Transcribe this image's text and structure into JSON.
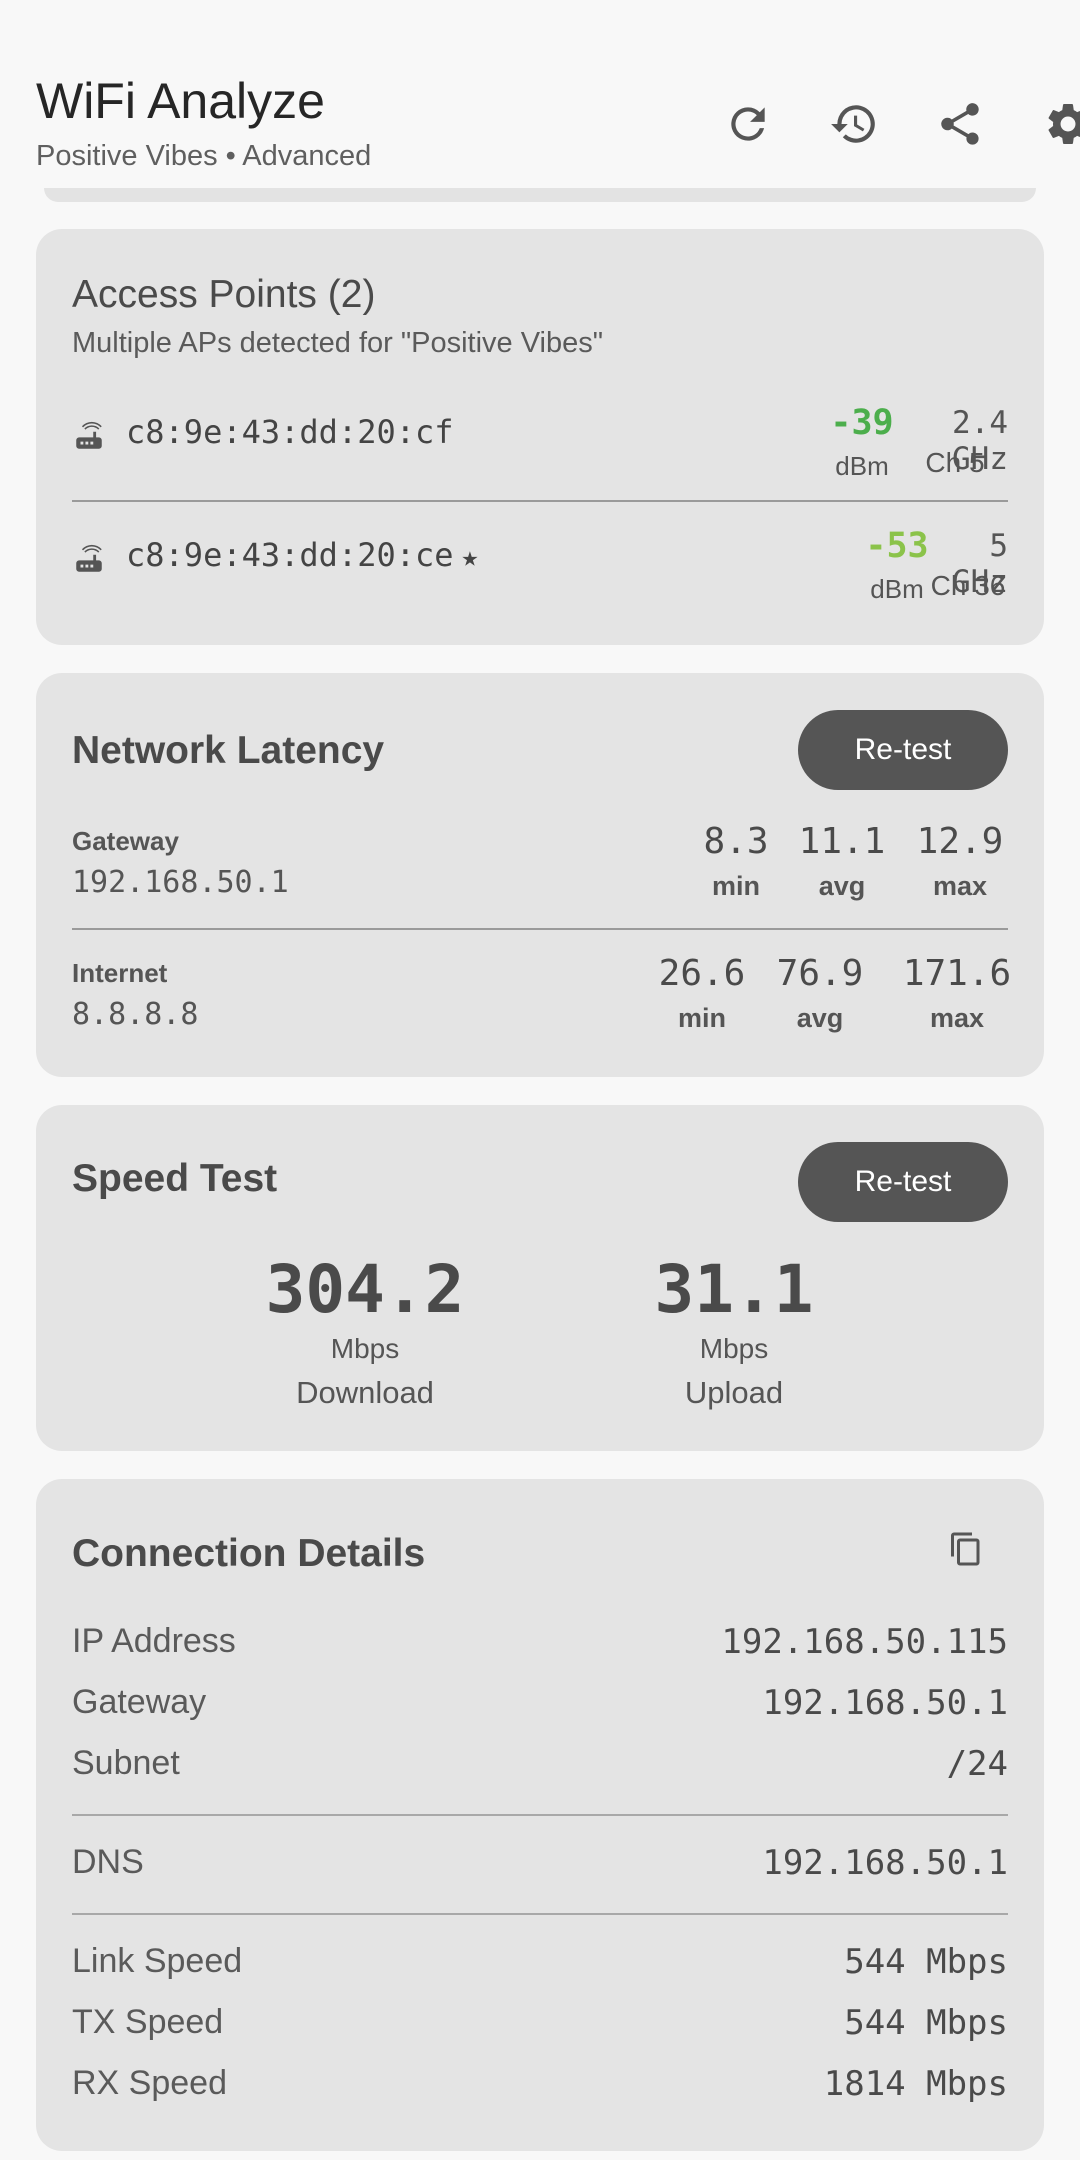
{
  "app": {
    "title": "WiFi Analyze",
    "subtitle": "Positive Vibes • Advanced"
  },
  "icons": {
    "refresh": "refresh-icon",
    "history": "history-icon",
    "share": "share-icon",
    "settings": "gear-icon",
    "router": "router-icon",
    "copy": "copy-icon"
  },
  "colors": {
    "strong_signal": "#4cae4c",
    "good_signal": "#8bc34a",
    "button": "#555555",
    "card": "#e4e4e4"
  },
  "access_points": {
    "title": "Access Points (2)",
    "subtitle": "Multiple APs detected for \"Positive Vibes\"",
    "items": [
      {
        "bssid": "c8:9e:43:dd:20:cf",
        "connected": "",
        "rssi": "-39",
        "rssi_unit": "dBm",
        "band": "2.4 GHz",
        "channel": "Ch 5"
      },
      {
        "bssid": "c8:9e:43:dd:20:ce",
        "connected": "★",
        "rssi": "-53",
        "rssi_unit": "dBm",
        "band": "5 GHz",
        "channel": "Ch 36"
      }
    ]
  },
  "latency": {
    "title": "Network Latency",
    "retest_label": "Re-test",
    "rows": [
      {
        "label": "Gateway",
        "host": "192.168.50.1",
        "min": "8.3",
        "avg": "11.1",
        "max": "12.9"
      },
      {
        "label": "Internet",
        "host": "8.8.8.8",
        "min": "26.6",
        "avg": "76.9",
        "max": "171.6"
      }
    ],
    "min_label": "min",
    "avg_label": "avg",
    "max_label": "max"
  },
  "speed": {
    "title": "Speed Test",
    "retest_label": "Re-test",
    "download": {
      "value": "304.2",
      "unit": "Mbps",
      "label": "Download"
    },
    "upload": {
      "value": "31.1",
      "unit": "Mbps",
      "label": "Upload"
    }
  },
  "connection": {
    "title": "Connection Details",
    "rows": [
      {
        "label": "IP Address",
        "value": "192.168.50.115"
      },
      {
        "label": "Gateway",
        "value": "192.168.50.1"
      },
      {
        "label": "Subnet",
        "value": "/24"
      },
      {
        "label": "DNS",
        "value": "192.168.50.1"
      },
      {
        "label": "Link Speed",
        "value": "544 Mbps"
      },
      {
        "label": "TX Speed",
        "value": "544 Mbps"
      },
      {
        "label": "RX Speed",
        "value": "1814 Mbps"
      }
    ]
  }
}
